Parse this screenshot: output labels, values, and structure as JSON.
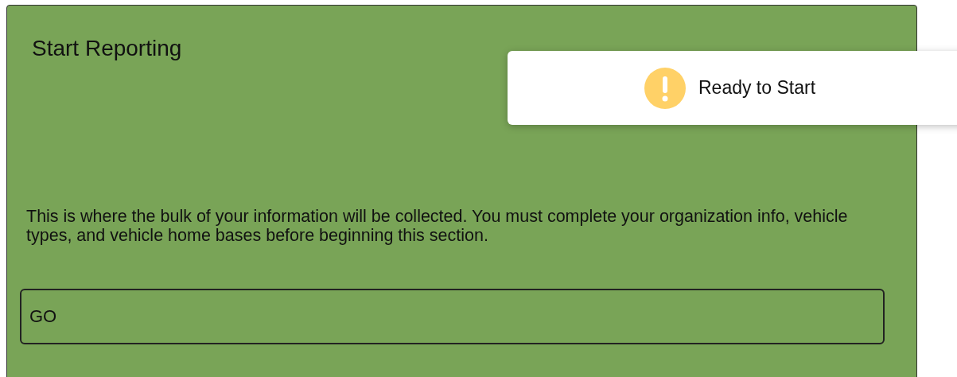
{
  "card": {
    "title": "Start Reporting",
    "description": "This is where the bulk of your information will be collected. You must complete your organization info, vehicle types, and vehicle home bases before beginning this section.",
    "button": "GO"
  },
  "toast": {
    "kind": "warning",
    "message": "Ready to Start"
  }
}
